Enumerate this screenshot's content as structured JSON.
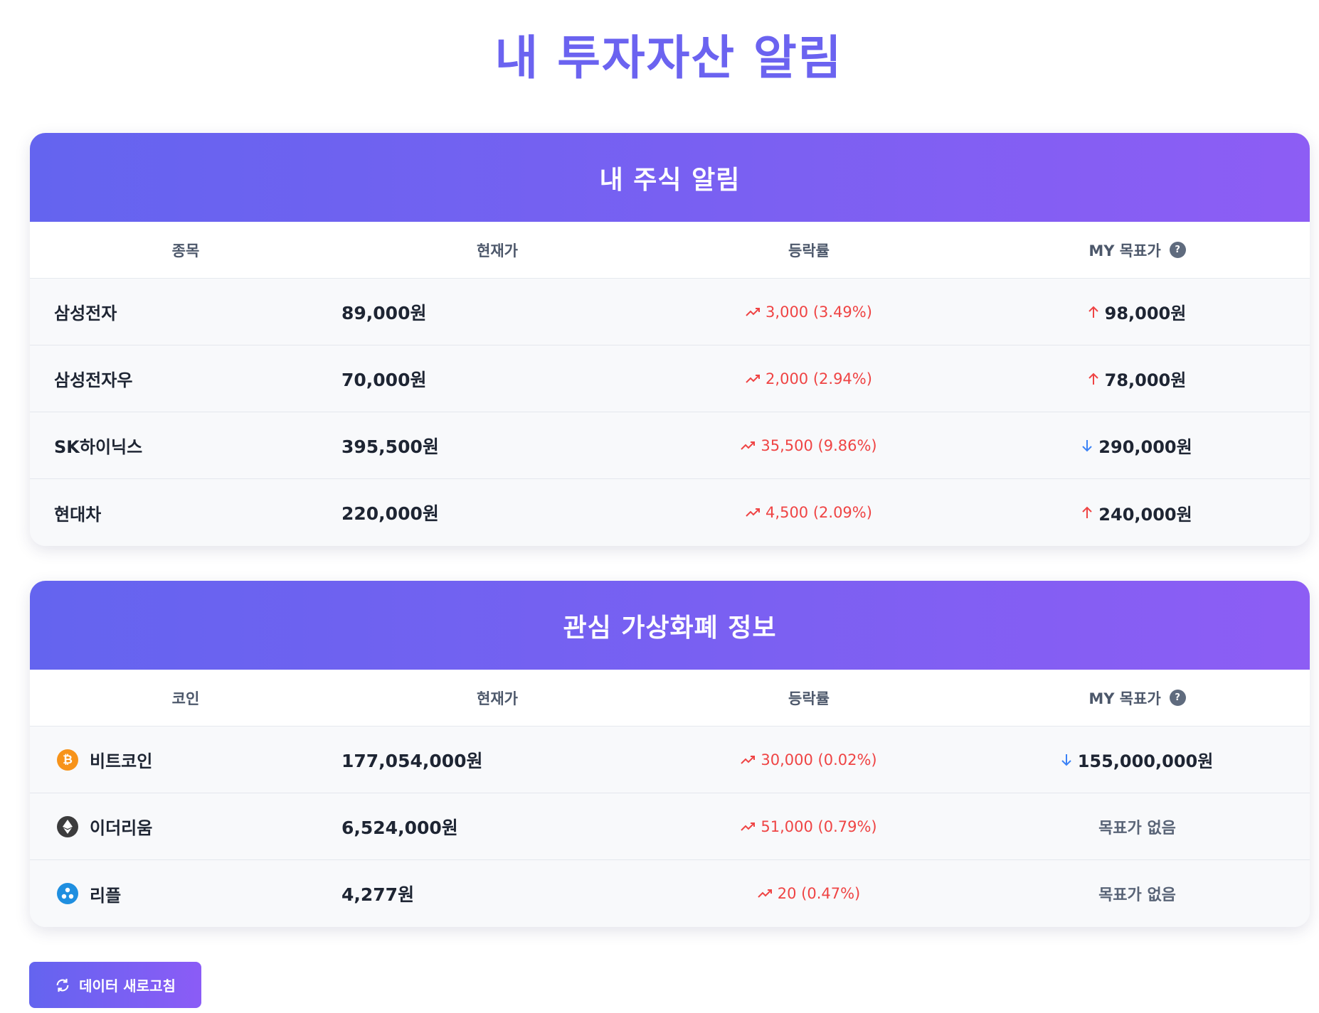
{
  "page": {
    "title": "내 투자자산 알림"
  },
  "stocks": {
    "header": "내 주식 알림",
    "columns": [
      "종목",
      "현재가",
      "등락률",
      "MY 목표가"
    ],
    "rows": [
      {
        "name": "삼성전자",
        "price": "89,000원",
        "change": "3,000 (3.49%)",
        "target": "98,000원",
        "target_direction": "up"
      },
      {
        "name": "삼성전자우",
        "price": "70,000원",
        "change": "2,000 (2.94%)",
        "target": "78,000원",
        "target_direction": "up"
      },
      {
        "name": "SK하이닉스",
        "price": "395,500원",
        "change": "35,500 (9.86%)",
        "target": "290,000원",
        "target_direction": "down"
      },
      {
        "name": "현대차",
        "price": "220,000원",
        "change": "4,500 (2.09%)",
        "target": "240,000원",
        "target_direction": "up"
      }
    ]
  },
  "coins": {
    "header": "관심 가상화폐 정보",
    "columns": [
      "코인",
      "현재가",
      "등락률",
      "MY 목표가"
    ],
    "rows": [
      {
        "name": "비트코인",
        "icon": "bitcoin-icon",
        "icon_color": "#f7931a",
        "price": "177,054,000원",
        "change": "30,000 (0.02%)",
        "target": "155,000,000원",
        "target_direction": "down"
      },
      {
        "name": "이더리움",
        "icon": "ethereum-icon",
        "icon_color": "#3c3c3d",
        "price": "6,524,000원",
        "change": "51,000 (0.79%)",
        "target": "목표가 없음",
        "target_direction": "none"
      },
      {
        "name": "리플",
        "icon": "ripple-icon",
        "icon_color": "#1f8fe0",
        "price": "4,277원",
        "change": "20 (0.47%)",
        "target": "목표가 없음",
        "target_direction": "none"
      }
    ]
  },
  "refresh_button": {
    "label": "데이터 새로고침"
  },
  "colors": {
    "accent": "#6b63f0",
    "positive": "#ef4444",
    "down_arrow": "#3b82f6"
  }
}
